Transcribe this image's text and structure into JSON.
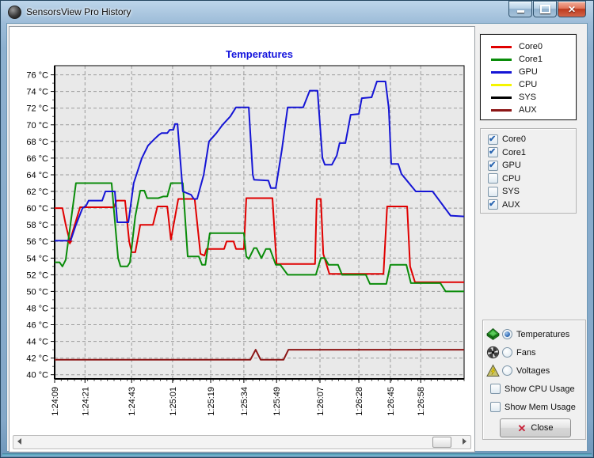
{
  "window": {
    "title": "SensorsView Pro History",
    "controls": {
      "minimize": "minimize",
      "maximize": "maximize",
      "close": "✕"
    }
  },
  "legend": {
    "items": [
      {
        "label": "Core0",
        "color": "#e00000"
      },
      {
        "label": "Core1",
        "color": "#0a8c0a"
      },
      {
        "label": "GPU",
        "color": "#1515d5"
      },
      {
        "label": "CPU",
        "color": "#f5f500"
      },
      {
        "label": "SYS",
        "color": "#000000"
      },
      {
        "label": "AUX",
        "color": "#8c1616"
      }
    ]
  },
  "series_toggles": [
    {
      "label": "Core0",
      "checked": true
    },
    {
      "label": "Core1",
      "checked": true
    },
    {
      "label": "GPU",
      "checked": true
    },
    {
      "label": "CPU",
      "checked": false
    },
    {
      "label": "SYS",
      "checked": false
    },
    {
      "label": "AUX",
      "checked": true
    }
  ],
  "modes": [
    {
      "label": "Temperatures",
      "icon": "chip-icon",
      "selected": true
    },
    {
      "label": "Fans",
      "icon": "fan-icon",
      "selected": false
    },
    {
      "label": "Voltages",
      "icon": "voltage-icon",
      "selected": false
    }
  ],
  "options": [
    {
      "label": "Show CPU Usage",
      "checked": false
    },
    {
      "label": "Show Mem Usage",
      "checked": false
    }
  ],
  "close_button": {
    "label": "Close",
    "icon": "✕"
  },
  "chart_data": {
    "type": "line",
    "title": "Temperatures",
    "title_color": "#1414dd",
    "y_unit": "°C",
    "ylim": [
      39.5,
      77.1
    ],
    "y_ticks": [
      76,
      74,
      72,
      70,
      68,
      66,
      64,
      62,
      60,
      58,
      56,
      54,
      52,
      50,
      48,
      46,
      44,
      42,
      40
    ],
    "x_ticks": [
      {
        "label": "1:24:09",
        "f": 0
      },
      {
        "label": "1:24:21",
        "f": 0.074
      },
      {
        "label": "1:24:43",
        "f": 0.188
      },
      {
        "label": "1:25:01",
        "f": 0.288
      },
      {
        "label": "1:25:19",
        "f": 0.381
      },
      {
        "label": "1:25:34",
        "f": 0.462
      },
      {
        "label": "1:25:49",
        "f": 0.542
      },
      {
        "label": "1:26:07",
        "f": 0.648
      },
      {
        "label": "1:26:28",
        "f": 0.743
      },
      {
        "label": "1:26:45",
        "f": 0.82
      },
      {
        "label": "1:26:58",
        "f": 0.894
      }
    ],
    "grid": "dashed",
    "plot_bg": "#e9e9e9",
    "legend_position": "top-right-outside",
    "series": [
      {
        "name": "Core0",
        "color": "#e00000",
        "visible": true,
        "points": [
          [
            0,
            60
          ],
          [
            0.019,
            60
          ],
          [
            0.027,
            58
          ],
          [
            0.037,
            56
          ],
          [
            0.062,
            60.1
          ],
          [
            0.145,
            60.1
          ],
          [
            0.151,
            60.9
          ],
          [
            0.172,
            60.9
          ],
          [
            0.182,
            56
          ],
          [
            0.188,
            54.7
          ],
          [
            0.197,
            54.7
          ],
          [
            0.209,
            58
          ],
          [
            0.24,
            58
          ],
          [
            0.251,
            60.2
          ],
          [
            0.275,
            60.2
          ],
          [
            0.284,
            56.2
          ],
          [
            0.302,
            61.1
          ],
          [
            0.342,
            61.1
          ],
          [
            0.356,
            54.5
          ],
          [
            0.366,
            54.3
          ],
          [
            0.371,
            55.1
          ],
          [
            0.414,
            55.1
          ],
          [
            0.42,
            56
          ],
          [
            0.437,
            56
          ],
          [
            0.443,
            55.1
          ],
          [
            0.462,
            55.1
          ],
          [
            0.468,
            61.2
          ],
          [
            0.532,
            61.2
          ],
          [
            0.542,
            53.3
          ],
          [
            0.636,
            53.3
          ],
          [
            0.64,
            61.1
          ],
          [
            0.65,
            61.1
          ],
          [
            0.656,
            54.5
          ],
          [
            0.671,
            52.1
          ],
          [
            0.803,
            52.1
          ],
          [
            0.812,
            60.2
          ],
          [
            0.861,
            60.2
          ],
          [
            0.868,
            53
          ],
          [
            0.88,
            51.1
          ],
          [
            1,
            51.1
          ]
        ]
      },
      {
        "name": "Core1",
        "color": "#0a8c0a",
        "visible": true,
        "points": [
          [
            0,
            53.5
          ],
          [
            0.012,
            53.5
          ],
          [
            0.019,
            53
          ],
          [
            0.027,
            53.8
          ],
          [
            0.052,
            63
          ],
          [
            0.139,
            63
          ],
          [
            0.155,
            54
          ],
          [
            0.161,
            53
          ],
          [
            0.178,
            53
          ],
          [
            0.184,
            53.5
          ],
          [
            0.197,
            59
          ],
          [
            0.209,
            62.1
          ],
          [
            0.219,
            62.1
          ],
          [
            0.226,
            61.2
          ],
          [
            0.253,
            61.2
          ],
          [
            0.265,
            61.4
          ],
          [
            0.275,
            61.4
          ],
          [
            0.284,
            63
          ],
          [
            0.313,
            63
          ],
          [
            0.325,
            54.2
          ],
          [
            0.352,
            54.2
          ],
          [
            0.36,
            53.2
          ],
          [
            0.368,
            53.2
          ],
          [
            0.379,
            57
          ],
          [
            0.462,
            57
          ],
          [
            0.468,
            54.2
          ],
          [
            0.474,
            53.9
          ],
          [
            0.487,
            55.2
          ],
          [
            0.493,
            55.2
          ],
          [
            0.505,
            54
          ],
          [
            0.516,
            55.1
          ],
          [
            0.526,
            55.1
          ],
          [
            0.54,
            53.2
          ],
          [
            0.551,
            53.2
          ],
          [
            0.569,
            52
          ],
          [
            0.638,
            52
          ],
          [
            0.65,
            54
          ],
          [
            0.66,
            54
          ],
          [
            0.669,
            53.2
          ],
          [
            0.692,
            53.2
          ],
          [
            0.702,
            52
          ],
          [
            0.76,
            52
          ],
          [
            0.77,
            50.9
          ],
          [
            0.81,
            50.9
          ],
          [
            0.82,
            53.2
          ],
          [
            0.859,
            53.2
          ],
          [
            0.87,
            51
          ],
          [
            0.942,
            51
          ],
          [
            0.955,
            50
          ],
          [
            1,
            50
          ]
        ]
      },
      {
        "name": "GPU",
        "color": "#1515d5",
        "visible": true,
        "points": [
          [
            0,
            56.1
          ],
          [
            0.039,
            56.1
          ],
          [
            0.052,
            58
          ],
          [
            0.068,
            60
          ],
          [
            0.077,
            60.3
          ],
          [
            0.083,
            60.9
          ],
          [
            0.116,
            60.9
          ],
          [
            0.124,
            62
          ],
          [
            0.147,
            62
          ],
          [
            0.153,
            58.3
          ],
          [
            0.18,
            58.3
          ],
          [
            0.193,
            63
          ],
          [
            0.213,
            66
          ],
          [
            0.228,
            67.5
          ],
          [
            0.244,
            68.3
          ],
          [
            0.255,
            68.8
          ],
          [
            0.261,
            69
          ],
          [
            0.275,
            69
          ],
          [
            0.281,
            69.4
          ],
          [
            0.29,
            69.4
          ],
          [
            0.294,
            70.1
          ],
          [
            0.3,
            70.1
          ],
          [
            0.313,
            62
          ],
          [
            0.333,
            61.6
          ],
          [
            0.34,
            61.1
          ],
          [
            0.348,
            61.1
          ],
          [
            0.364,
            64
          ],
          [
            0.377,
            68
          ],
          [
            0.395,
            69
          ],
          [
            0.41,
            70
          ],
          [
            0.429,
            71
          ],
          [
            0.443,
            72.1
          ],
          [
            0.474,
            72.1
          ],
          [
            0.484,
            64
          ],
          [
            0.487,
            63.4
          ],
          [
            0.522,
            63.3
          ],
          [
            0.528,
            62.4
          ],
          [
            0.54,
            62.4
          ],
          [
            0.555,
            67
          ],
          [
            0.569,
            72.1
          ],
          [
            0.607,
            72.1
          ],
          [
            0.623,
            74.1
          ],
          [
            0.642,
            74.1
          ],
          [
            0.654,
            66
          ],
          [
            0.66,
            65.2
          ],
          [
            0.677,
            65.2
          ],
          [
            0.689,
            66.3
          ],
          [
            0.696,
            67.8
          ],
          [
            0.71,
            67.8
          ],
          [
            0.723,
            71.2
          ],
          [
            0.743,
            71.3
          ],
          [
            0.75,
            73.2
          ],
          [
            0.774,
            73.3
          ],
          [
            0.787,
            75.2
          ],
          [
            0.808,
            75.2
          ],
          [
            0.816,
            72
          ],
          [
            0.822,
            65.3
          ],
          [
            0.839,
            65.3
          ],
          [
            0.847,
            64.1
          ],
          [
            0.882,
            62
          ],
          [
            0.923,
            62
          ],
          [
            0.967,
            59.1
          ],
          [
            1,
            59
          ]
        ]
      },
      {
        "name": "CPU",
        "color": "#f5f500",
        "visible": false,
        "points": []
      },
      {
        "name": "SYS",
        "color": "#000000",
        "visible": false,
        "points": []
      },
      {
        "name": "AUX",
        "color": "#8c1616",
        "visible": true,
        "points": [
          [
            0,
            41.8
          ],
          [
            0.478,
            41.8
          ],
          [
            0.491,
            43
          ],
          [
            0.503,
            41.8
          ],
          [
            0.559,
            41.8
          ],
          [
            0.571,
            43
          ],
          [
            1,
            43
          ]
        ]
      }
    ],
    "marker": {
      "series": "Core0",
      "f": 0.037,
      "v": 56
    }
  }
}
